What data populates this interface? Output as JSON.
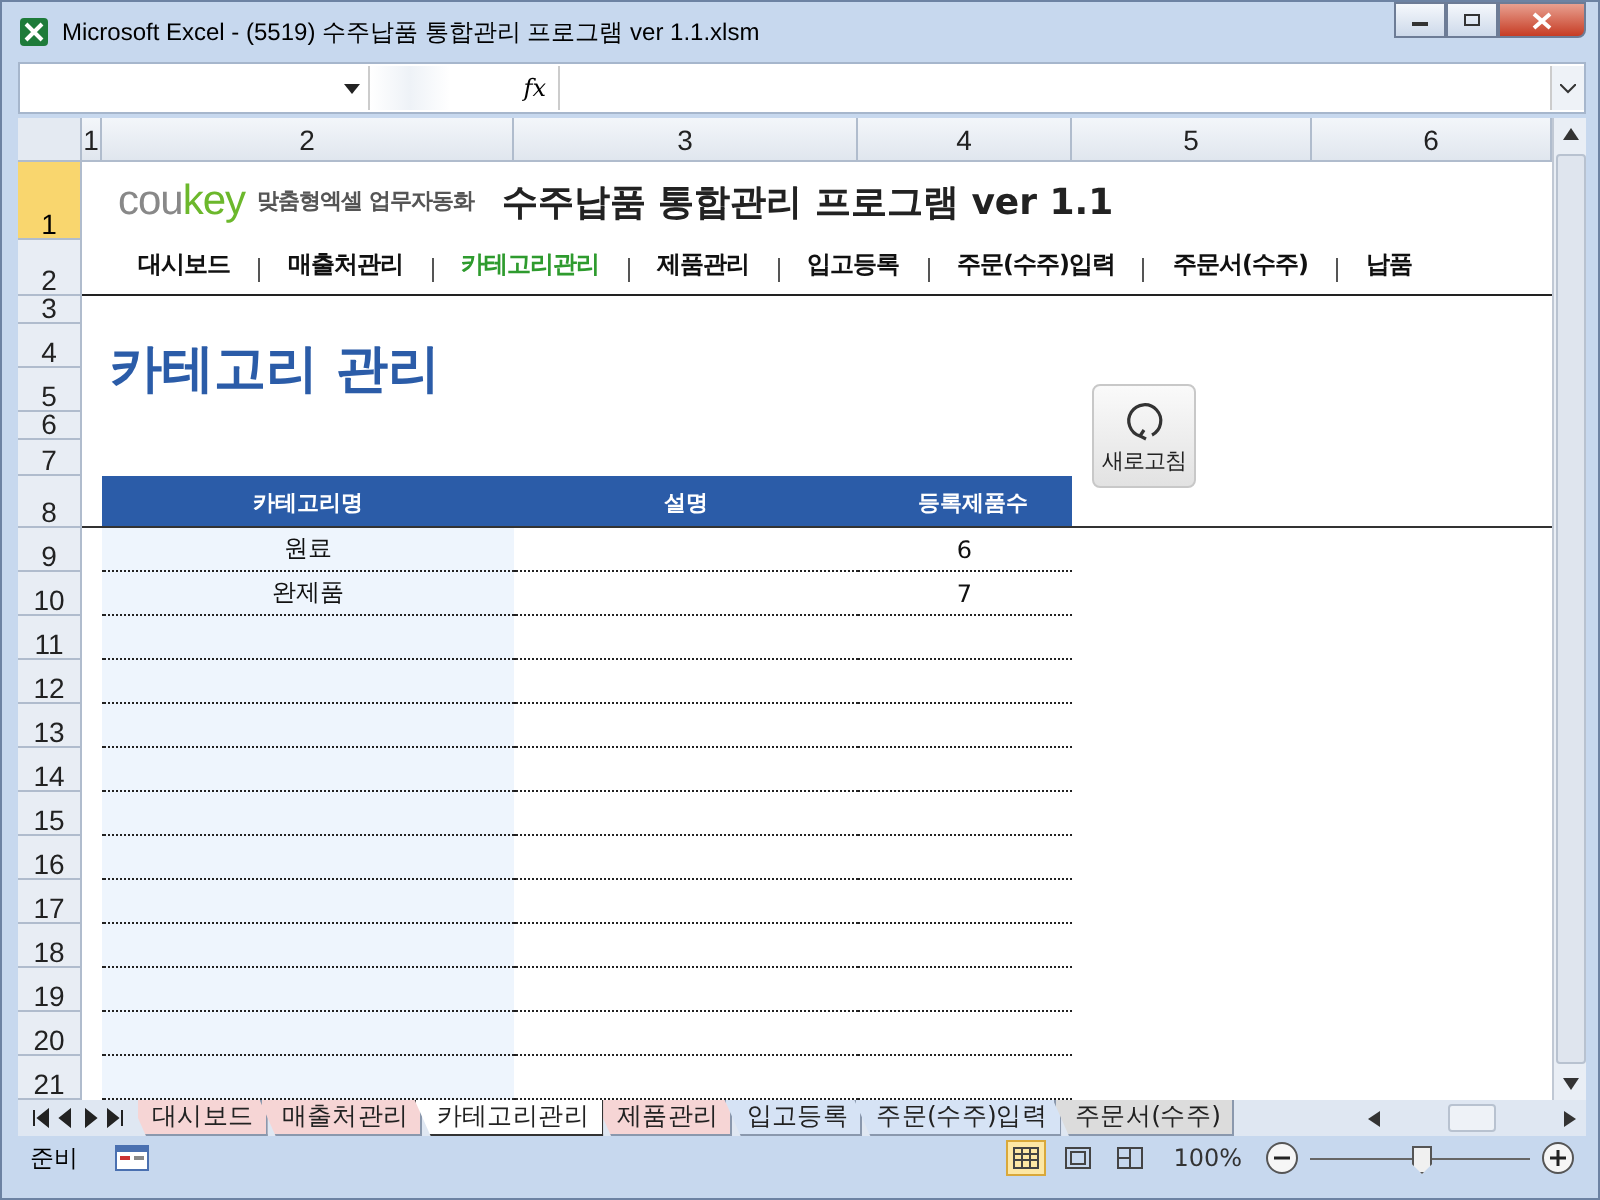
{
  "window": {
    "title": "Microsoft Excel - (5519) 수주납품 통합관리 프로그램 ver 1.1.xlsm"
  },
  "formula_bar": {
    "fx": "fx"
  },
  "columns": [
    "1",
    "2",
    "3",
    "4",
    "5",
    "6"
  ],
  "row_numbers": [
    "1",
    "2",
    "3",
    "4",
    "5",
    "6",
    "7",
    "8",
    "9",
    "10",
    "11",
    "12",
    "13",
    "14",
    "15",
    "16",
    "17",
    "18",
    "19",
    "20",
    "21"
  ],
  "banner": {
    "logo": [
      "cou",
      "key"
    ],
    "tagline": "맞춤형엑셀 업무자동화",
    "title": "수주납품 통합관리 프로그램 ver 1.1"
  },
  "nav": [
    {
      "label": "대시보드",
      "selected": false
    },
    {
      "label": "매출처관리",
      "selected": false
    },
    {
      "label": "카테고리관리",
      "selected": true
    },
    {
      "label": "제품관리",
      "selected": false
    },
    {
      "label": "입고등록",
      "selected": false
    },
    {
      "label": "주문(수주)입력",
      "selected": false
    },
    {
      "label": "주문서(수주)",
      "selected": false
    },
    {
      "label": "납품",
      "selected": false
    }
  ],
  "page_title": "카테고리 관리",
  "refresh_button": "새로고침",
  "table": {
    "columns": [
      "카테고리명",
      "설명",
      "등록제품수"
    ],
    "rows": [
      {
        "name": "원료",
        "description": "",
        "count": "6"
      },
      {
        "name": "완제품",
        "description": "",
        "count": "7"
      }
    ]
  },
  "sheet_tabs": [
    {
      "label": "대시보드",
      "selected": false,
      "color": "#f6d5d5"
    },
    {
      "label": "매출처관리",
      "selected": false,
      "color": "#f6d5d5"
    },
    {
      "label": "카테고리관리",
      "selected": true,
      "color": "#ffffff"
    },
    {
      "label": "제품관리",
      "selected": false,
      "color": "#f6d5d5"
    },
    {
      "label": "입고등록",
      "selected": false,
      "color": "#d6e3f5"
    },
    {
      "label": "주문(수주)입력",
      "selected": false,
      "color": "#d6e3f5"
    },
    {
      "label": "주문서(수주)",
      "selected": false,
      "color": "#dcdcdc"
    }
  ],
  "status_bar": {
    "status": "준비",
    "zoom": "100%",
    "zoom_slider": {
      "level": 0.5
    }
  }
}
